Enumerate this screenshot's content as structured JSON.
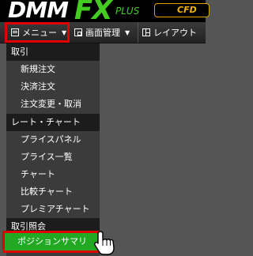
{
  "header": {
    "logo_dmm": "DMM",
    "logo_fx": "FX",
    "logo_plus": "PLUS",
    "cfd_label": "CFD"
  },
  "toolbar": {
    "menu_label": "メニュー",
    "screen_label": "画面管理",
    "layout_label": "レイアウト"
  },
  "menu": {
    "sections": [
      {
        "title": "取引",
        "items": [
          "新規注文",
          "決済注文",
          "注文変更・取消"
        ]
      },
      {
        "title": "レート・チャート",
        "items": [
          "プライスパネル",
          "プライス一覧",
          "チャート",
          "比較チャート",
          "プレミアチャート"
        ]
      },
      {
        "title": "取引照会",
        "items": [
          "ポジションサマリ"
        ]
      }
    ]
  },
  "colors": {
    "accent_green": "#23a823",
    "highlight_red": "#e00000",
    "cfd_gold": "#f2b400"
  }
}
